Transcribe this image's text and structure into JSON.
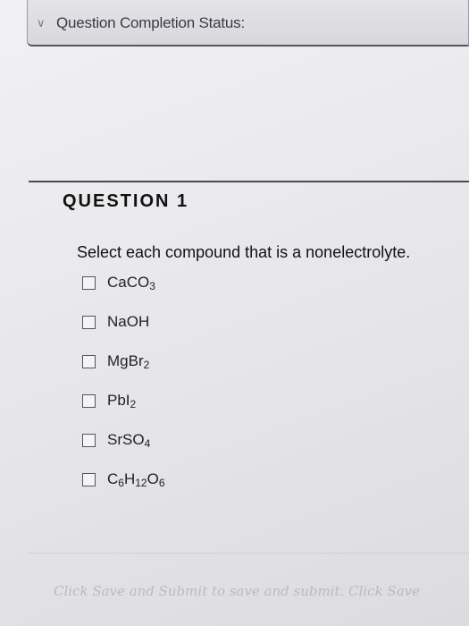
{
  "header": {
    "chevron_icon": "chevron-down-icon",
    "status_title": "Question Completion Status:"
  },
  "question": {
    "heading": "QUESTION 1",
    "prompt": "Select each compound that is a nonelectrolyte.",
    "options": [
      {
        "parts": [
          "CaCO",
          "3"
        ],
        "checked": false
      },
      {
        "parts": [
          "NaOH"
        ],
        "checked": false
      },
      {
        "parts": [
          "MgBr",
          "2"
        ],
        "checked": false
      },
      {
        "parts": [
          "PbI",
          "2"
        ],
        "checked": false
      },
      {
        "parts": [
          "SrSO",
          "4"
        ],
        "checked": false
      },
      {
        "parts": [
          "C",
          "6",
          "H",
          "12",
          "O",
          "6"
        ],
        "checked": false
      }
    ]
  },
  "footer": {
    "note": "Click Save and Submit to save and submit. Click Save"
  },
  "colors": {
    "border_dark": "#4a4a52",
    "status_bg": "#d7d7dc",
    "footer_text": "#b9b9c4"
  }
}
